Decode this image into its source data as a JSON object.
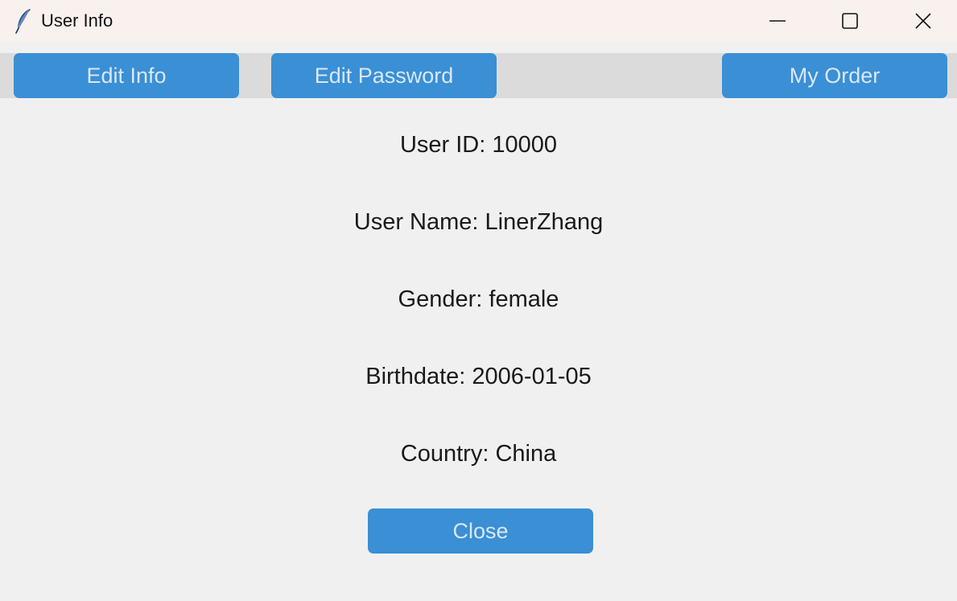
{
  "window": {
    "title": "User Info",
    "icon": "feather-icon"
  },
  "window_controls": {
    "minimize_icon": "minimize-icon",
    "maximize_icon": "maximize-icon",
    "close_icon": "close-icon"
  },
  "toolbar": {
    "edit_info_label": "Edit Info",
    "edit_password_label": "Edit Password",
    "my_order_label": "My Order"
  },
  "user_info": {
    "user_id": "User ID: 10000",
    "user_name": "User Name: LinerZhang",
    "gender": "Gender: female",
    "birthdate": "Birthdate: 2006-01-05",
    "country": "Country: China"
  },
  "actions": {
    "close_label": "Close"
  },
  "colors": {
    "titlebar_bg": "#f9f1ed",
    "toolbar_bg": "#dbdbdb",
    "content_bg": "#f0f0f0",
    "button_bg": "#3a8fd5",
    "button_text": "#d9e7f5"
  }
}
